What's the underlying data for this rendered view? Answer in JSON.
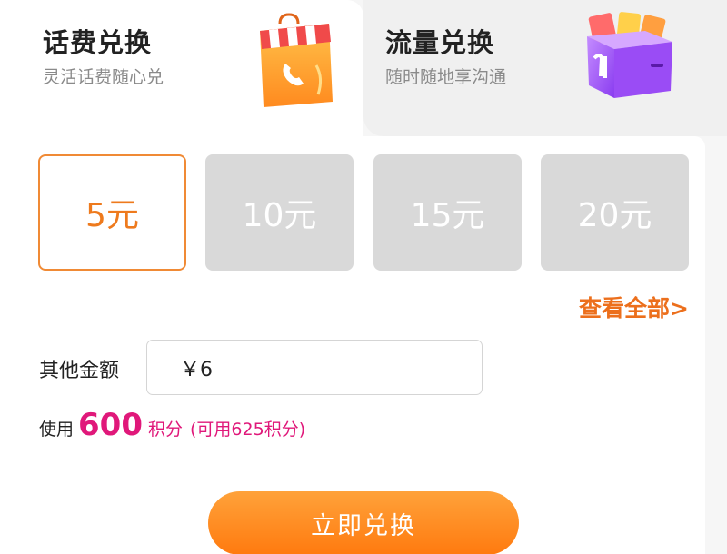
{
  "tabs": [
    {
      "title": "话费兑换",
      "subtitle": "灵活话费随心兑",
      "icon": "shopping-bag-phone-icon",
      "active": true
    },
    {
      "title": "流量兑换",
      "subtitle": "随时随地享沟通",
      "icon": "data-gift-box-icon",
      "active": false
    }
  ],
  "amounts": [
    {
      "label": "5元",
      "selected": true
    },
    {
      "label": "10元",
      "selected": false
    },
    {
      "label": "15元",
      "selected": false
    },
    {
      "label": "20元",
      "selected": false
    }
  ],
  "view_all": "查看全部>",
  "other_amount": {
    "label": "其他金额",
    "value": "￥6"
  },
  "points": {
    "prefix": "使用",
    "amount": "600",
    "unit": "积分",
    "available": "(可用625积分)"
  },
  "submit_label": "立即兑换",
  "colors": {
    "accent_orange": "#ee7a1d",
    "points_pink": "#e0187a",
    "button_from": "#ffa23a",
    "button_to": "#ff7a0f",
    "unselected": "#d9d9d9"
  }
}
